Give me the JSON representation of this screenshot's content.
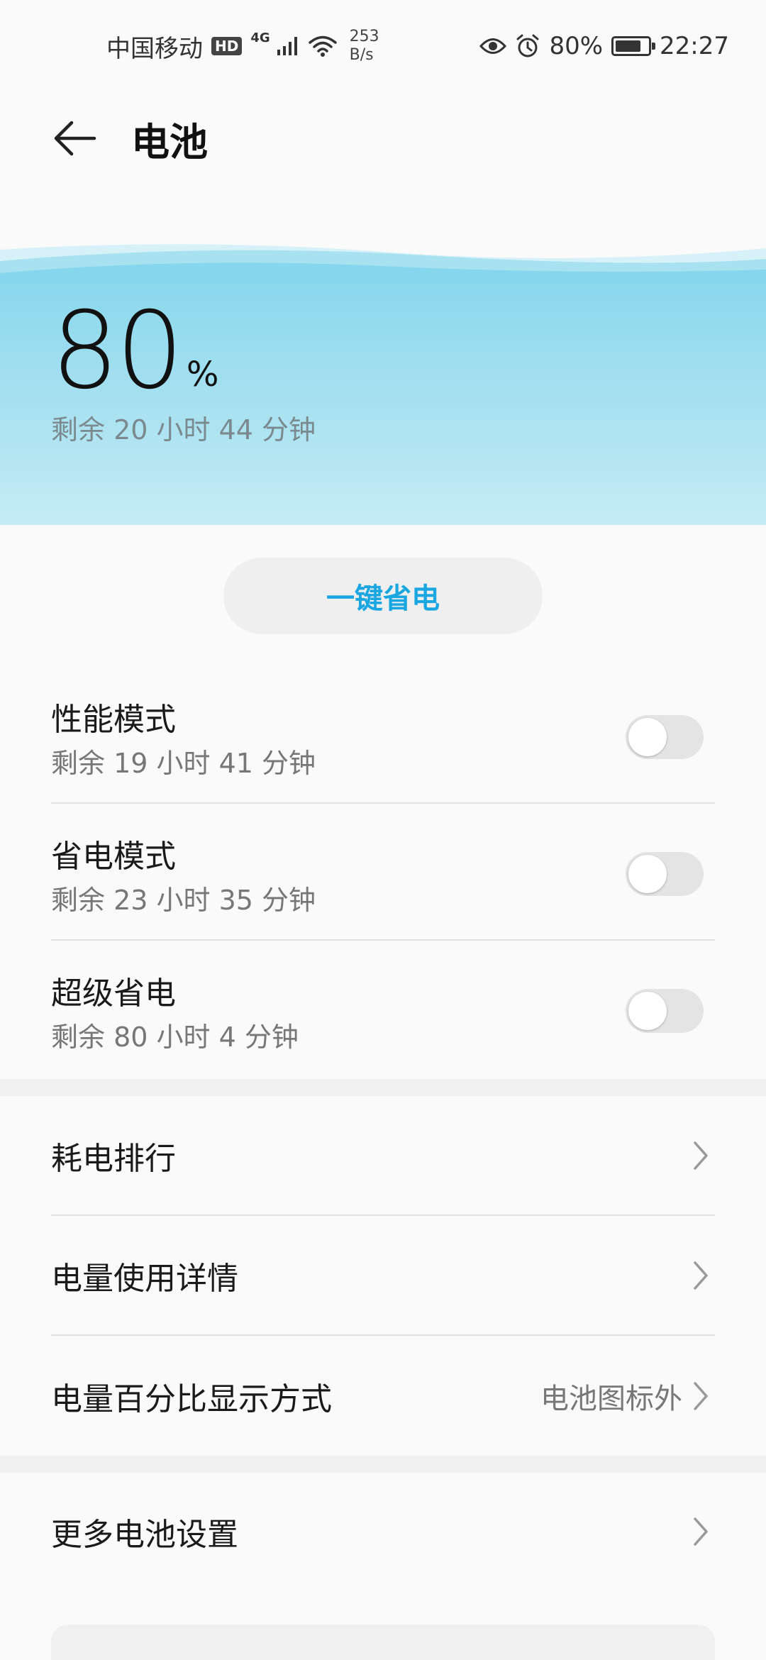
{
  "status_bar": {
    "carrier": "中国移动",
    "hd": "HD",
    "network": "4G",
    "speed_value": "253",
    "speed_unit": "B/s",
    "battery_percent": "80%",
    "battery_level": 0.8,
    "time": "22:27"
  },
  "header": {
    "title": "电池"
  },
  "hero": {
    "percent_value": "80",
    "percent_sign": "%",
    "remaining": "剩余 20 小时 44 分钟",
    "color_top": "#7fd4ec",
    "color_bottom": "#c4ecf5"
  },
  "save_button": {
    "label": "一键省电",
    "color": "#1aa6e0"
  },
  "modes": [
    {
      "title": "性能模式",
      "subtitle": "剩余 19 小时 41 分钟",
      "enabled": false
    },
    {
      "title": "省电模式",
      "subtitle": "剩余 23 小时 35 分钟",
      "enabled": false
    },
    {
      "title": "超级省电",
      "subtitle": "剩余 80 小时 4 分钟",
      "enabled": false
    }
  ],
  "nav_items": [
    {
      "label": "耗电排行",
      "value": ""
    },
    {
      "label": "电量使用详情",
      "value": ""
    },
    {
      "label": "电量百分比显示方式",
      "value": "电池图标外"
    }
  ],
  "more_settings": {
    "label": "更多电池设置"
  }
}
